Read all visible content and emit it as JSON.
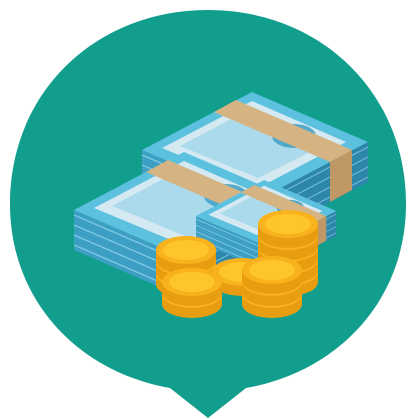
{
  "illustration": {
    "subject": "money-pile-icon",
    "colors": {
      "badge": "#119e8d",
      "bill_top": "#5bc1df",
      "bill_front": "#3e9fc4",
      "bill_side": "#2f86ab",
      "bill_panel": "#d4e9f1",
      "band": "#d6b382",
      "band_dark": "#bf9866",
      "coin_face": "#ffc62c",
      "coin_edge": "#e89d11",
      "coin_rim": "#f7b21d"
    }
  }
}
